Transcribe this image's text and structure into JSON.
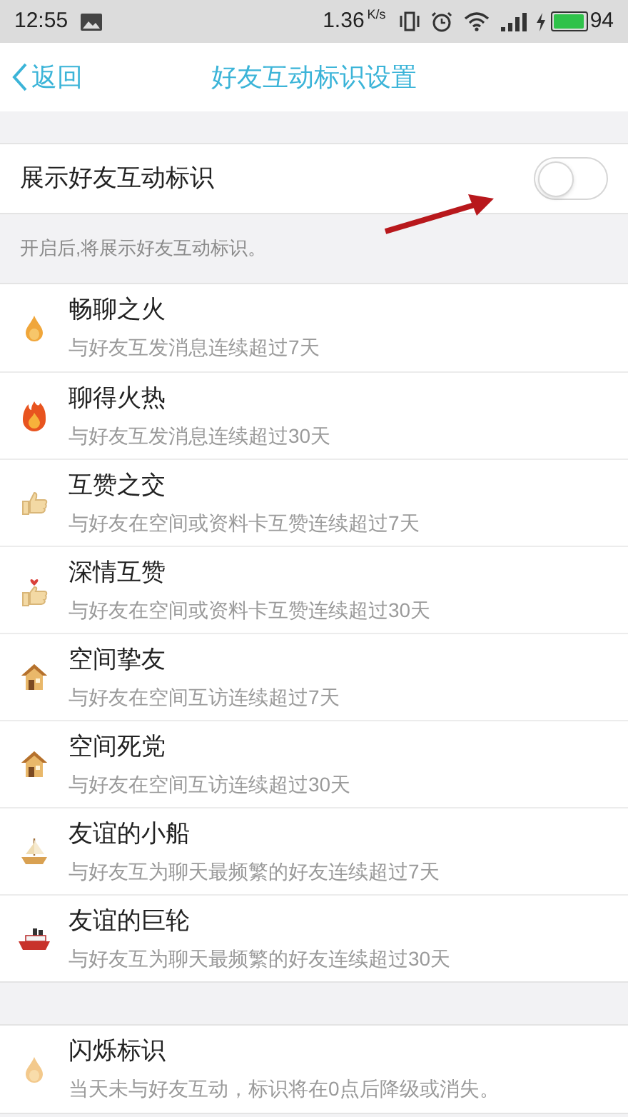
{
  "status_bar": {
    "time": "12:55",
    "speed": "1.36",
    "speed_unit": "K/s",
    "battery": "94"
  },
  "nav": {
    "back": "返回",
    "title": "好友互动标识设置"
  },
  "master_toggle": {
    "label": "展示好友互动标识",
    "on": false,
    "hint": "开启后,将展示好友互动标识。"
  },
  "marks": [
    {
      "kind": "flame",
      "title": "畅聊之火",
      "description": "与好友互发消息连续超过7天"
    },
    {
      "kind": "blaze",
      "title": "聊得火热",
      "description": "与好友互发消息连续超过30天"
    },
    {
      "kind": "thumb",
      "title": "互赞之交",
      "description": "与好友在空间或资料卡互赞连续超过7天"
    },
    {
      "kind": "heartthumb",
      "title": "深情互赞",
      "description": "与好友在空间或资料卡互赞连续超过30天"
    },
    {
      "kind": "house",
      "title": "空间挚友",
      "description": "与好友在空间互访连续超过7天"
    },
    {
      "kind": "house",
      "title": "空间死党",
      "description": "与好友在空间互访连续超过30天"
    },
    {
      "kind": "sailboat",
      "title": "友谊的小船",
      "description": "与好友互为聊天最频繁的好友连续超过7天"
    },
    {
      "kind": "ship",
      "title": "友谊的巨轮",
      "description": "与好友互为聊天最频繁的好友连续超过30天"
    }
  ],
  "extra_marks": [
    {
      "kind": "fading",
      "title": "闪烁标识",
      "description": "当天未与好友互动，标识将在0点后降级或消失。"
    }
  ]
}
